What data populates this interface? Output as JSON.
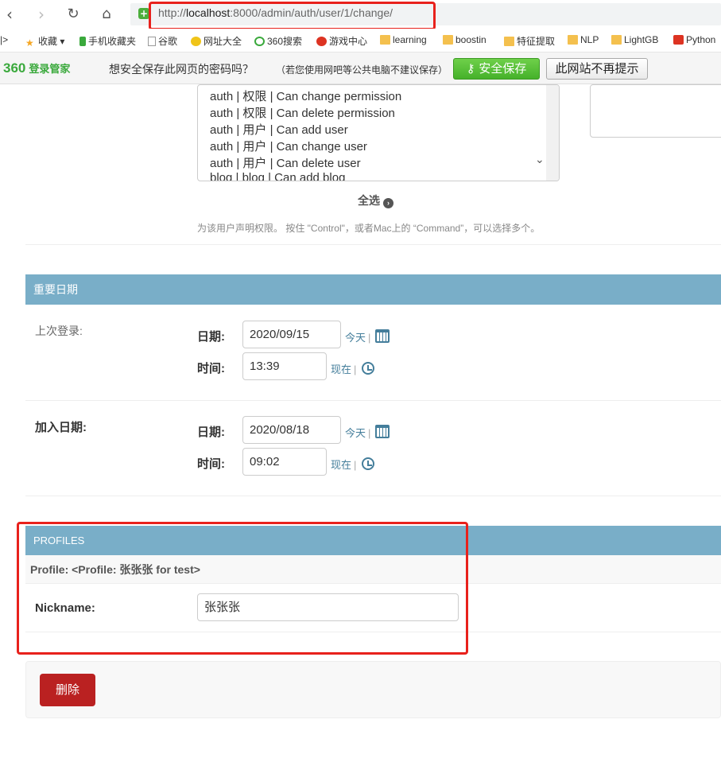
{
  "browser": {
    "url_prefix": "http://",
    "url_host": "localhost",
    "url_rest": ":8000/admin/auth/user/1/change/",
    "bookmarks": [
      "收藏",
      "手机收藏夹",
      "谷歌",
      "网址大全",
      "360搜索",
      "游戏中心",
      "learning",
      "boostin",
      "特征提取",
      "NLP",
      "LightGB",
      "Python"
    ]
  },
  "password_bar": {
    "logo": "360",
    "logo_text": "登录管家",
    "question": "想安全保存此网页的密码吗？",
    "note": "（若您使用网吧等公共电脑不建议保存）",
    "save_label": "安全保存",
    "never_label": "此网站不再提示"
  },
  "permissions": {
    "options": [
      "auth | 权限 | Can change permission",
      "auth | 权限 | Can delete permission",
      "auth | 用户 | Can add user",
      "auth | 用户 | Can change user",
      "auth | 用户 | Can delete user",
      "blog | blog | Can add blog"
    ],
    "choose_all": "全选",
    "help_text": "为该用户声明权限。 按住 \"Control\"，或者Mac上的 “Command”，可以选择多个。"
  },
  "dates_module": {
    "title": "重要日期",
    "last_login": {
      "label": "上次登录:",
      "date_label": "日期:",
      "date_value": "2020/09/15",
      "today": "今天",
      "time_label": "时间:",
      "time_value": "13:39",
      "now": "现在"
    },
    "date_joined": {
      "label": "加入日期:",
      "date_label": "日期:",
      "date_value": "2020/08/18",
      "today": "今天",
      "time_label": "时间:",
      "time_value": "09:02",
      "now": "现在"
    }
  },
  "profiles": {
    "title": "PROFILES",
    "subtitle": "Profile: <Profile: 张张张 for test>",
    "nickname_label": "Nickname:",
    "nickname_value": "张张张"
  },
  "actions": {
    "delete_label": "删除"
  },
  "colors": {
    "module_header": "#79aec8",
    "link": "#447e9b",
    "delete": "#ba2121",
    "highlight_box": "#e8211c"
  }
}
